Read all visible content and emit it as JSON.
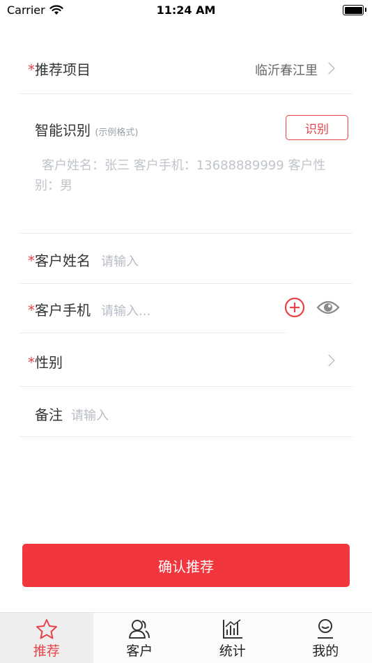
{
  "status_bar": {
    "carrier": "Carrier",
    "time": "11:24 AM"
  },
  "form": {
    "project": {
      "required_mark": "*",
      "label": "推荐项目",
      "value": "临沂春江里"
    },
    "smart": {
      "label": "智能识别",
      "hint": "(示例格式)",
      "button": "识别",
      "sample": "客户姓名：张三  客户手机：13688889999  客户性别：男"
    },
    "name": {
      "required_mark": "*",
      "label": "客户姓名",
      "placeholder": "请输入"
    },
    "phone": {
      "required_mark": "*",
      "label": "客户手机",
      "placeholder": "请输入..."
    },
    "gender": {
      "required_mark": "*",
      "label": "性别"
    },
    "remark": {
      "label": "备注",
      "placeholder": "请输入"
    }
  },
  "confirm_button": "确认推荐",
  "tabs": [
    {
      "label": "推荐",
      "icon": "star-icon",
      "active": true
    },
    {
      "label": "客户",
      "icon": "users-icon",
      "active": false
    },
    {
      "label": "统计",
      "icon": "chart-icon",
      "active": false
    },
    {
      "label": "我的",
      "icon": "profile-icon",
      "active": false
    }
  ],
  "colors": {
    "accent": "#e8434a",
    "button": "#f2363d",
    "placeholder": "#b7bcc6"
  }
}
